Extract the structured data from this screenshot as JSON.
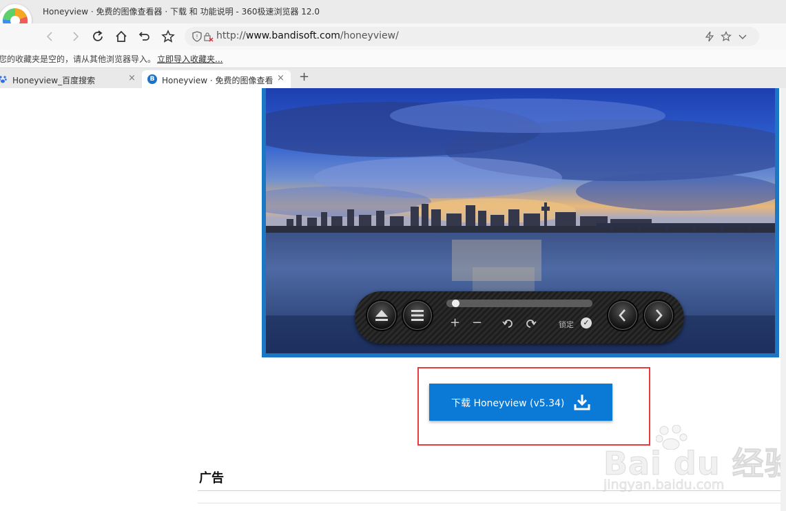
{
  "browser": {
    "window_title": "Honeyview · 免费的图像查看器 · 下载 和 功能说明 - 360极速浏览器 12.0",
    "address": {
      "scheme": "http://",
      "domain": "www.bandisoft.com",
      "path": "/honeyview/"
    },
    "bookmark_bar": {
      "message": "您的收藏夹是空的，请从其他浏览器导入。",
      "import_link": "立即导入收藏夹..."
    },
    "tabs": [
      {
        "label": "Honeyview_百度搜索",
        "close": "×"
      },
      {
        "label": "Honeyview · 免费的图像查看",
        "close": "×"
      }
    ],
    "new_tab": "+"
  },
  "page": {
    "viewer_controls": {
      "lock_label": "锁定",
      "check": "✓",
      "plus": "+",
      "minus": "−"
    },
    "download_button": {
      "label": "下载 Honeyview (v5.34)"
    },
    "ad_heading": "广告"
  },
  "watermark": {
    "brand": "Bai du 经验",
    "site": "jingyan.baidu.com"
  },
  "colors": {
    "accent_blue": "#0a7ad6",
    "highlight_red": "#e8393e"
  }
}
